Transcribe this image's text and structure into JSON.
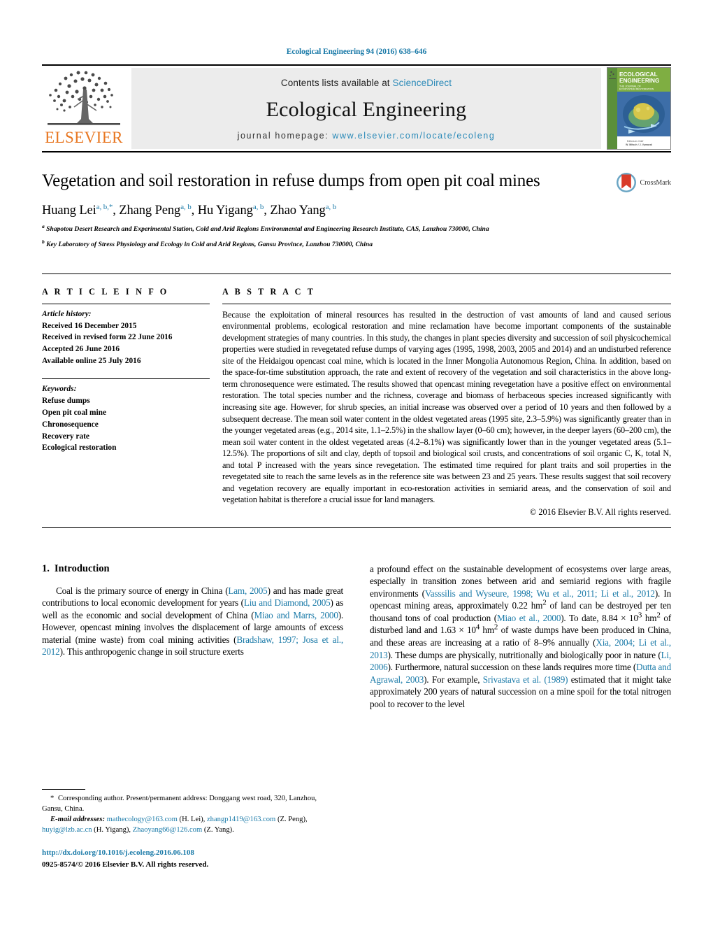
{
  "running_head": "Ecological Engineering 94 (2016) 638–646",
  "masthead": {
    "publisher_name": "ELSEVIER",
    "contents_prefix": "Contents lists available at ",
    "contents_link": "ScienceDirect",
    "journal_name": "Ecological Engineering",
    "homepage_prefix": "journal homepage: ",
    "homepage_url": "www.elsevier.com/locate/ecoleng",
    "cover": {
      "line1": "ECOLOGICAL",
      "line2": "ENGINEERING",
      "line3": "THE JOURNAL OF",
      "line4": "ECOSYSTEM RESTORATION",
      "footer1": "Editors-in-Chief",
      "footer2": "W. Mitsch / J. Vymazal"
    }
  },
  "article": {
    "title": "Vegetation and soil restoration in refuse dumps from open pit coal mines",
    "crossmark_label": "CrossMark",
    "authors_html": "Huang Lei<sup>a, b,</sup><sup>*</sup>, Zhang Peng<sup>a, b</sup>, Hu Yigang<sup>a, b</sup>, Zhao Yang<sup>a, b</sup>",
    "affiliations": [
      {
        "marker": "a",
        "text": "Shapotou Desert Research and Experimental Station, Cold and Arid Regions Environmental and Engineering Research Institute, CAS, Lanzhou 730000, China"
      },
      {
        "marker": "b",
        "text": "Key Laboratory of Stress Physiology and Ecology in Cold and Arid Regions, Gansu Province, Lanzhou 730000, China"
      }
    ]
  },
  "article_info": {
    "heading": "A R T I C L E   I N F O",
    "history_label": "Article history:",
    "history": [
      "Received 16 December 2015",
      "Received in revised form 22 June 2016",
      "Accepted 26 June 2016",
      "Available online 25 July 2016"
    ],
    "keywords_label": "Keywords:",
    "keywords": [
      "Refuse dumps",
      "Open pit coal mine",
      "Chronosequence",
      "Recovery rate",
      "Ecological restoration"
    ]
  },
  "abstract": {
    "heading": "A B S T R A C T",
    "text": "Because the exploitation of mineral resources has resulted in the destruction of vast amounts of land and caused serious environmental problems, ecological restoration and mine reclamation have become important components of the sustainable development strategies of many countries. In this study, the changes in plant species diversity and succession of soil physicochemical properties were studied in revegetated refuse dumps of varying ages (1995, 1998, 2003, 2005 and 2014) and an undisturbed reference site of the Heidaigou opencast coal mine, which is located in the Inner Mongolia Autonomous Region, China. In addition, based on the space-for-time substitution approach, the rate and extent of recovery of the vegetation and soil characteristics in the above long-term chronosequence were estimated. The results showed that opencast mining revegetation have a positive effect on environmental restoration. The total species number and the richness, coverage and biomass of herbaceous species increased significantly with increasing site age. However, for shrub species, an initial increase was observed over a period of 10 years and then followed by a subsequent decrease. The mean soil water content in the oldest vegetated areas (1995 site, 2.3–5.9%) was significantly greater than in the younger vegetated areas (e.g., 2014 site, 1.1–2.5%) in the shallow layer (0–60 cm); however, in the deeper layers (60–200 cm), the mean soil water content in the oldest vegetated areas (4.2–8.1%) was significantly lower than in the younger vegetated areas (5.1–12.5%). The proportions of silt and clay, depth of topsoil and biological soil crusts, and concentrations of soil organic C, K, total N, and total P increased with the years since revegetation. The estimated time required for plant traits and soil properties in the revegetated site to reach the same levels as in the reference site was between 23 and 25 years. These results suggest that soil recovery and vegetation recovery are equally important in eco-restoration activities in semiarid areas, and the conservation of soil and vegetation habitat is therefore a crucial issue for land managers.",
    "copyright": "© 2016 Elsevier B.V. All rights reserved."
  },
  "introduction": {
    "number": "1.",
    "heading": "Introduction",
    "left_paragraph_html": "Coal is the primary source of energy in China (<span class=\"lnk\">Lam, 2005</span>) and has made great contributions to local economic development for years (<span class=\"lnk\">Liu and Diamond, 2005</span>) as well as the economic and social development of China (<span class=\"lnk\">Miao and Marrs, 2000</span>). However, opencast mining involves the displacement of large amounts of excess material (mine waste) from coal mining activities (<span class=\"lnk\">Bradshaw, 1997; Josa et al., 2012</span>). This anthropogenic change in soil structure exerts",
    "right_paragraph_html": "a profound effect on the sustainable development of ecosystems over large areas, especially in transition zones between arid and semiarid regions with fragile environments (<span class=\"lnk\">Vasssilis and Wyseure, 1998; Wu et al., 2011; Li et al., 2012</span>). In opencast mining areas, approximately 0.22 hm<sup>2</sup> of land can be destroyed per ten thousand tons of coal production (<span class=\"lnk\">Miao et al., 2000</span>). To date, 8.84 × 10<sup>3</sup> hm<sup>2</sup> of disturbed land and 1.63 × 10<sup>4</sup> hm<sup>2</sup> of waste dumps have been produced in China, and these areas are increasing at a ratio of 8–9% annually (<span class=\"lnk\">Xia, 2004; Li et al., 2013</span>). These dumps are physically, nutritionally and biologically poor in nature (<span class=\"lnk\">Li, 2006</span>). Furthermore, natural succession on these lands requires more time (<span class=\"lnk\">Dutta and Agrawal, 2003</span>). For example, <span class=\"lnk\">Srivastava et al. (1989)</span> estimated that it might take approximately 200 years of natural succession on a mine spoil for the total nitrogen pool to recover to the level"
  },
  "footnotes": {
    "corresponding_html": "<span class=\"star\">*</span> <span>Corresponding author. Present/permanent address: Donggang west road, 320, Lanzhou, Gansu, China.</span>",
    "emails_html": "<span class=\"it\">E-mail addresses:</span> <span class=\"lnk\">mathecology@163.com</span> (H. Lei), <span class=\"lnk\">zhangp1419@163.com</span> (Z. Peng), <span class=\"lnk\">huyig@lzb.ac.cn</span> (H. Yigang), <span class=\"lnk\">Zhaoyang66@126.com</span> (Z. Yang).",
    "doi": "http://dx.doi.org/10.1016/j.ecoleng.2016.06.108",
    "issn_line": "0925-8574/© 2016 Elsevier B.V. All rights reserved."
  },
  "colors": {
    "link_blue": "#1a7aa8",
    "elsevier_orange": "#E87722",
    "masthead_grey": "#ececec"
  }
}
